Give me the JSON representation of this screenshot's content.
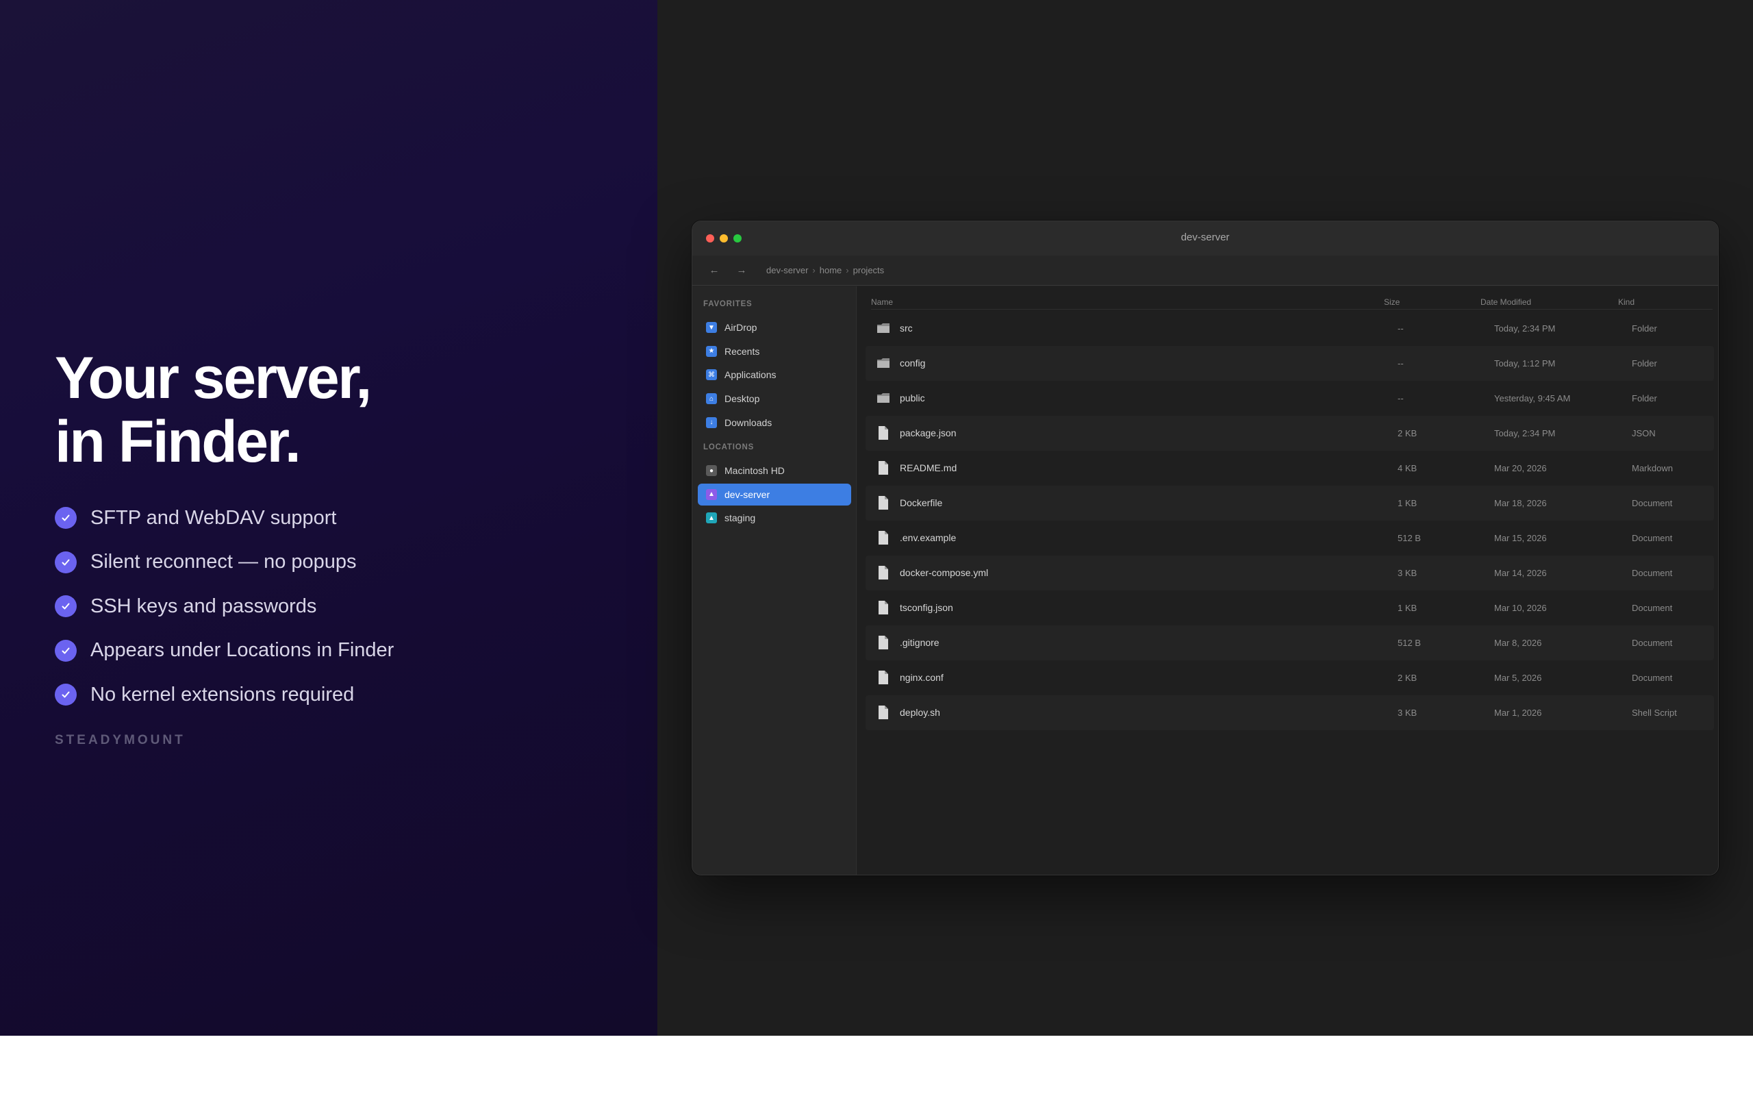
{
  "promo": {
    "headline_line1": "Your server,",
    "headline_line2": "in Finder.",
    "features": [
      "SFTP and WebDAV support",
      "Silent reconnect — no popups",
      "SSH keys and passwords",
      "Appears under Locations in Finder",
      "No kernel extensions required"
    ],
    "brand": "STEADYMOUNT",
    "accent_color": "#6b63f0"
  },
  "window": {
    "title": "dev-server",
    "nav": {
      "back_icon": "arrow-left-icon",
      "forward_icon": "arrow-right-icon"
    },
    "breadcrumbs": [
      "dev-server",
      "home",
      "projects"
    ],
    "breadcrumb_separator": "›"
  },
  "sidebar": {
    "favorites_label": "FAVORITES",
    "favorites": [
      {
        "label": "AirDrop",
        "icon": "airdrop-icon",
        "glyph": "▼",
        "color": "#3d7ee3"
      },
      {
        "label": "Recents",
        "icon": "recents-icon",
        "glyph": "★",
        "color": "#3d7ee3"
      },
      {
        "label": "Applications",
        "icon": "applications-icon",
        "glyph": "⌘",
        "color": "#3d7ee3"
      },
      {
        "label": "Desktop",
        "icon": "desktop-icon",
        "glyph": "⌂",
        "color": "#3d7ee3"
      },
      {
        "label": "Downloads",
        "icon": "downloads-icon",
        "glyph": "↓",
        "color": "#3d7ee3"
      }
    ],
    "locations_label": "LOCATIONS",
    "locations": [
      {
        "label": "Macintosh HD",
        "icon": "disk-icon",
        "glyph": "●",
        "color": "#5a5a5a"
      },
      {
        "label": "dev-server",
        "icon": "server-icon",
        "glyph": "▲",
        "color": "#8e5be8",
        "active": true
      },
      {
        "label": "staging",
        "icon": "server-icon",
        "glyph": "▲",
        "color": "#1fa6b8"
      }
    ]
  },
  "columns": {
    "name": "Name",
    "size": "Size",
    "date": "Date Modified",
    "kind": "Kind"
  },
  "files": [
    {
      "name": "src",
      "size": "--",
      "date": "Today, 2:34 PM",
      "kind": "Folder",
      "type": "folder"
    },
    {
      "name": "config",
      "size": "--",
      "date": "Today, 1:12 PM",
      "kind": "Folder",
      "type": "folder"
    },
    {
      "name": "public",
      "size": "--",
      "date": "Yesterday, 9:45 AM",
      "kind": "Folder",
      "type": "folder"
    },
    {
      "name": "package.json",
      "size": "2 KB",
      "date": "Today, 2:34 PM",
      "kind": "JSON",
      "type": "file"
    },
    {
      "name": "README.md",
      "size": "4 KB",
      "date": "Mar 20, 2026",
      "kind": "Markdown",
      "type": "file"
    },
    {
      "name": "Dockerfile",
      "size": "1 KB",
      "date": "Mar 18, 2026",
      "kind": "Document",
      "type": "file"
    },
    {
      "name": ".env.example",
      "size": "512 B",
      "date": "Mar 15, 2026",
      "kind": "Document",
      "type": "file"
    },
    {
      "name": "docker-compose.yml",
      "size": "3 KB",
      "date": "Mar 14, 2026",
      "kind": "Document",
      "type": "file"
    },
    {
      "name": "tsconfig.json",
      "size": "1 KB",
      "date": "Mar 10, 2026",
      "kind": "Document",
      "type": "file"
    },
    {
      "name": ".gitignore",
      "size": "512 B",
      "date": "Mar 8, 2026",
      "kind": "Document",
      "type": "file"
    },
    {
      "name": "nginx.conf",
      "size": "2 KB",
      "date": "Mar 5, 2026",
      "kind": "Document",
      "type": "file"
    },
    {
      "name": "deploy.sh",
      "size": "3 KB",
      "date": "Mar 1, 2026",
      "kind": "Shell Script",
      "type": "file"
    }
  ]
}
